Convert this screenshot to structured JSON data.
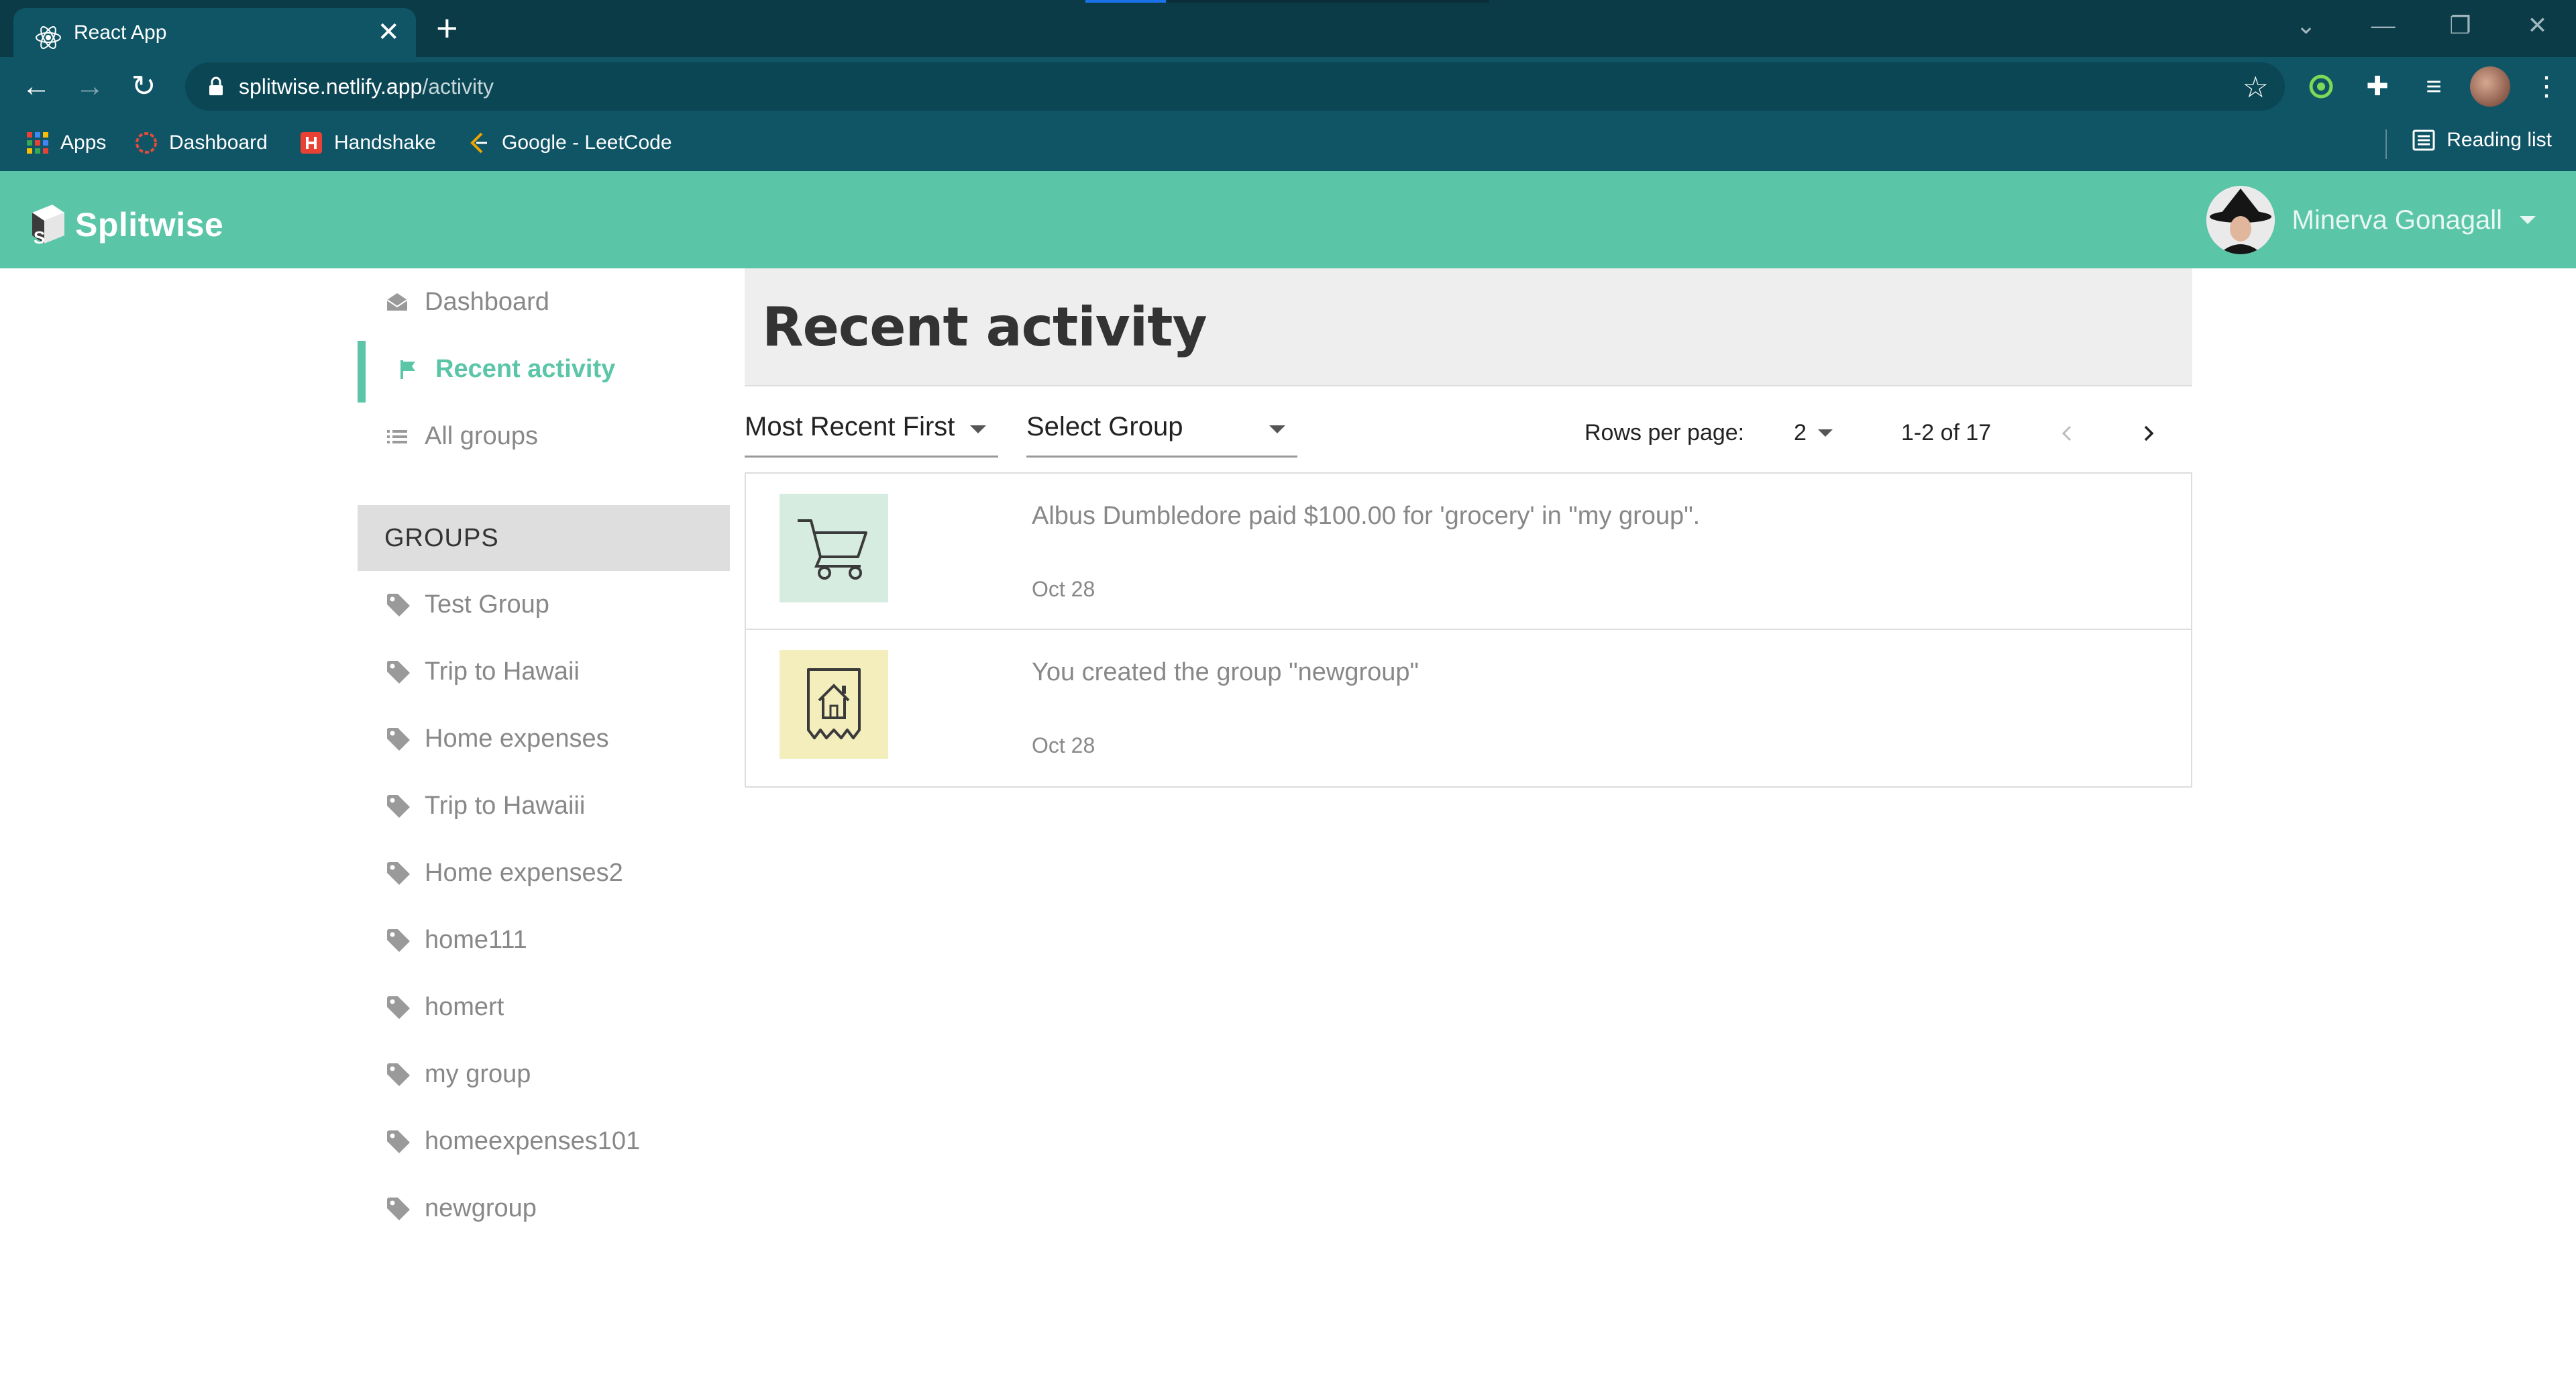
{
  "browser": {
    "tab_title": "React App",
    "tab_close": "✕",
    "new_tab": "+",
    "url_host": "splitwise.netlify.app",
    "url_path": "/activity",
    "bookmarks": [
      {
        "label": "Apps",
        "icon": "apps-grid-icon"
      },
      {
        "label": "Dashboard",
        "icon": "dashboard-favicon"
      },
      {
        "label": "Handshake",
        "icon": "handshake-favicon"
      },
      {
        "label": "Google - LeetCode",
        "icon": "leetcode-favicon"
      }
    ],
    "reading_list": "Reading list"
  },
  "app": {
    "brand": "Splitwise",
    "user_name": "Minerva Gonagall",
    "accent_color": "#5bc5a7"
  },
  "sidebar": {
    "nav": [
      {
        "label": "Dashboard",
        "icon": "envelope-icon"
      },
      {
        "label": "Recent activity",
        "icon": "flag-icon",
        "active": true
      },
      {
        "label": "All groups",
        "icon": "list-icon"
      }
    ],
    "groups_heading": "GROUPS",
    "groups": [
      "Test Group",
      "Trip to Hawaii",
      "Home expenses",
      "Trip to Hawaiii",
      "Home expenses2",
      "home111",
      "homert",
      "my group",
      "homeexpenses101",
      "newgroup"
    ]
  },
  "main": {
    "title": "Recent activity",
    "sort_select": "Most Recent First",
    "group_select": "Select Group",
    "rows_per_page_label": "Rows per page:",
    "rows_per_page_value": "2",
    "range": "1-2 of 17",
    "activities": [
      {
        "message": "Albus Dumbledore paid $100.00 for 'grocery' in \"my group\".",
        "date": "Oct 28",
        "icon": "cart-icon",
        "icon_bg": "#d6ece0"
      },
      {
        "message": "You created the group \"newgroup\"",
        "date": "Oct 28",
        "icon": "house-receipt-icon",
        "icon_bg": "#f3eebc"
      }
    ]
  }
}
